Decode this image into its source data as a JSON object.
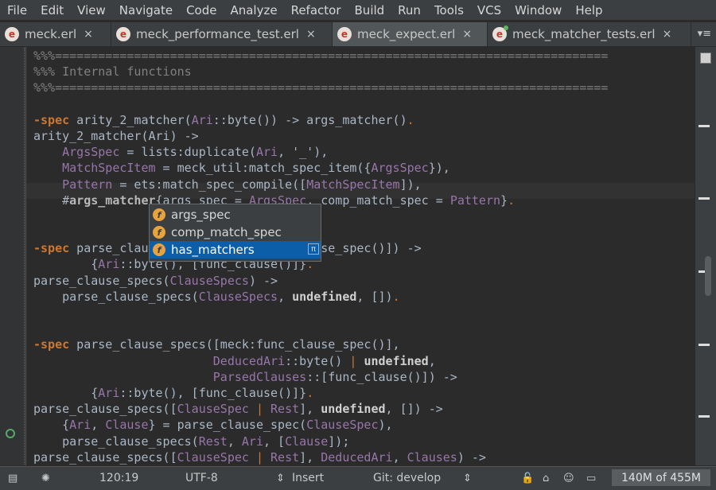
{
  "menu": [
    "File",
    "Edit",
    "View",
    "Navigate",
    "Code",
    "Analyze",
    "Refactor",
    "Build",
    "Run",
    "Tools",
    "VCS",
    "Window",
    "Help"
  ],
  "tabs": [
    {
      "icon_letter": "e",
      "label": "meck.erl",
      "close": "×"
    },
    {
      "icon_letter": "e",
      "label": "meck_performance_test.erl",
      "close": "×"
    },
    {
      "icon_letter": "e",
      "label": "meck_expect.erl",
      "close": "×"
    },
    {
      "icon_letter": "e",
      "label": "meck_matcher_tests.erl",
      "close": "×"
    }
  ],
  "tab_overflow": "▾≡",
  "code_lines": [
    "%%%=============================================================================",
    "%%% Internal functions",
    "%%%=============================================================================",
    "",
    "-spec arity_2_matcher(Ari::byte()) -> args_matcher().",
    "arity_2_matcher(Ari) ->",
    "    ArgsSpec = lists:duplicate(Ari, '_'),",
    "    MatchSpecItem = meck_util:match_spec_item({ArgsSpec}),",
    "    Pattern = ets:match_spec_compile([MatchSpecItem]),",
    "    #args_matcher{args_spec = ArgsSpec, comp_match_spec = Pattern}.",
    "",
    "",
    "-spec parse_clause_specs([meck:func_clause_spec()]) ->",
    "        {Ari::byte(), [func_clause()]}.",
    "parse_clause_specs(ClauseSpecs) ->",
    "    parse_clause_specs(ClauseSpecs, undefined, []).",
    "",
    "",
    "-spec parse_clause_specs([meck:func_clause_spec()],",
    "                         DeducedAri::byte() | undefined,",
    "                         ParsedClauses::[func_clause()]) ->",
    "        {Ari::byte(), [func_clause()]}.",
    "parse_clause_specs([ClauseSpec | Rest], undefined, []) ->",
    "    {Ari, Clause} = parse_clause_spec(ClauseSpec),",
    "    parse_clause_specs(Rest, Ari, [Clause]);",
    "parse_clause_specs([ClauseSpec | Rest], DeducedAri, Clauses) ->"
  ],
  "completion": {
    "items": [
      {
        "icon": "f",
        "label": "args_spec"
      },
      {
        "icon": "f",
        "label": "comp_match_spec"
      },
      {
        "icon": "f",
        "label": "has_matchers"
      }
    ],
    "selected_index": 2,
    "info_icon": "π"
  },
  "status": {
    "position": "120:19",
    "encoding": "UTF-8",
    "insert_mode": "Insert",
    "git": "Git: develop",
    "memory": "140M of 455M"
  }
}
